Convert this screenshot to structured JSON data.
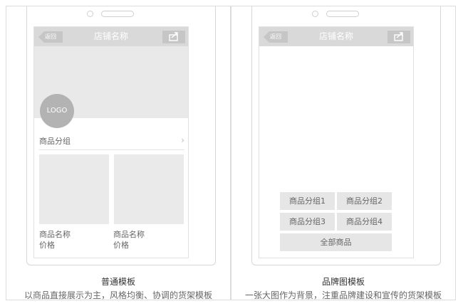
{
  "templates": [
    {
      "store_name": "店铺名称",
      "back_label": "返回",
      "logo_text": "LOGO",
      "group_label": "商品分组",
      "products": [
        {
          "name": "商品名称",
          "price": "价格"
        },
        {
          "name": "商品名称",
          "price": "价格"
        }
      ],
      "caption_title": "普通模板",
      "caption_desc": "以商品直接展示为主，风格均衡、协调的货架模板"
    },
    {
      "store_name": "店铺名称",
      "back_label": "返回",
      "buttons": [
        "商品分组1",
        "商品分组2",
        "商品分组3",
        "商品分组4"
      ],
      "all_label": "全部商品",
      "caption_title": "品牌图模板",
      "caption_desc": "一张大图作为背景，注重品牌建设和宣传的货架模板"
    }
  ],
  "icons": {
    "back": "back-arrow-icon",
    "share": "share-icon",
    "chevron": "chevron-right-icon"
  },
  "colors": {
    "nav_bg": "#d9d9d9",
    "placeholder_bg": "#e9e9e9",
    "logo_bg": "#b3b3b3"
  }
}
